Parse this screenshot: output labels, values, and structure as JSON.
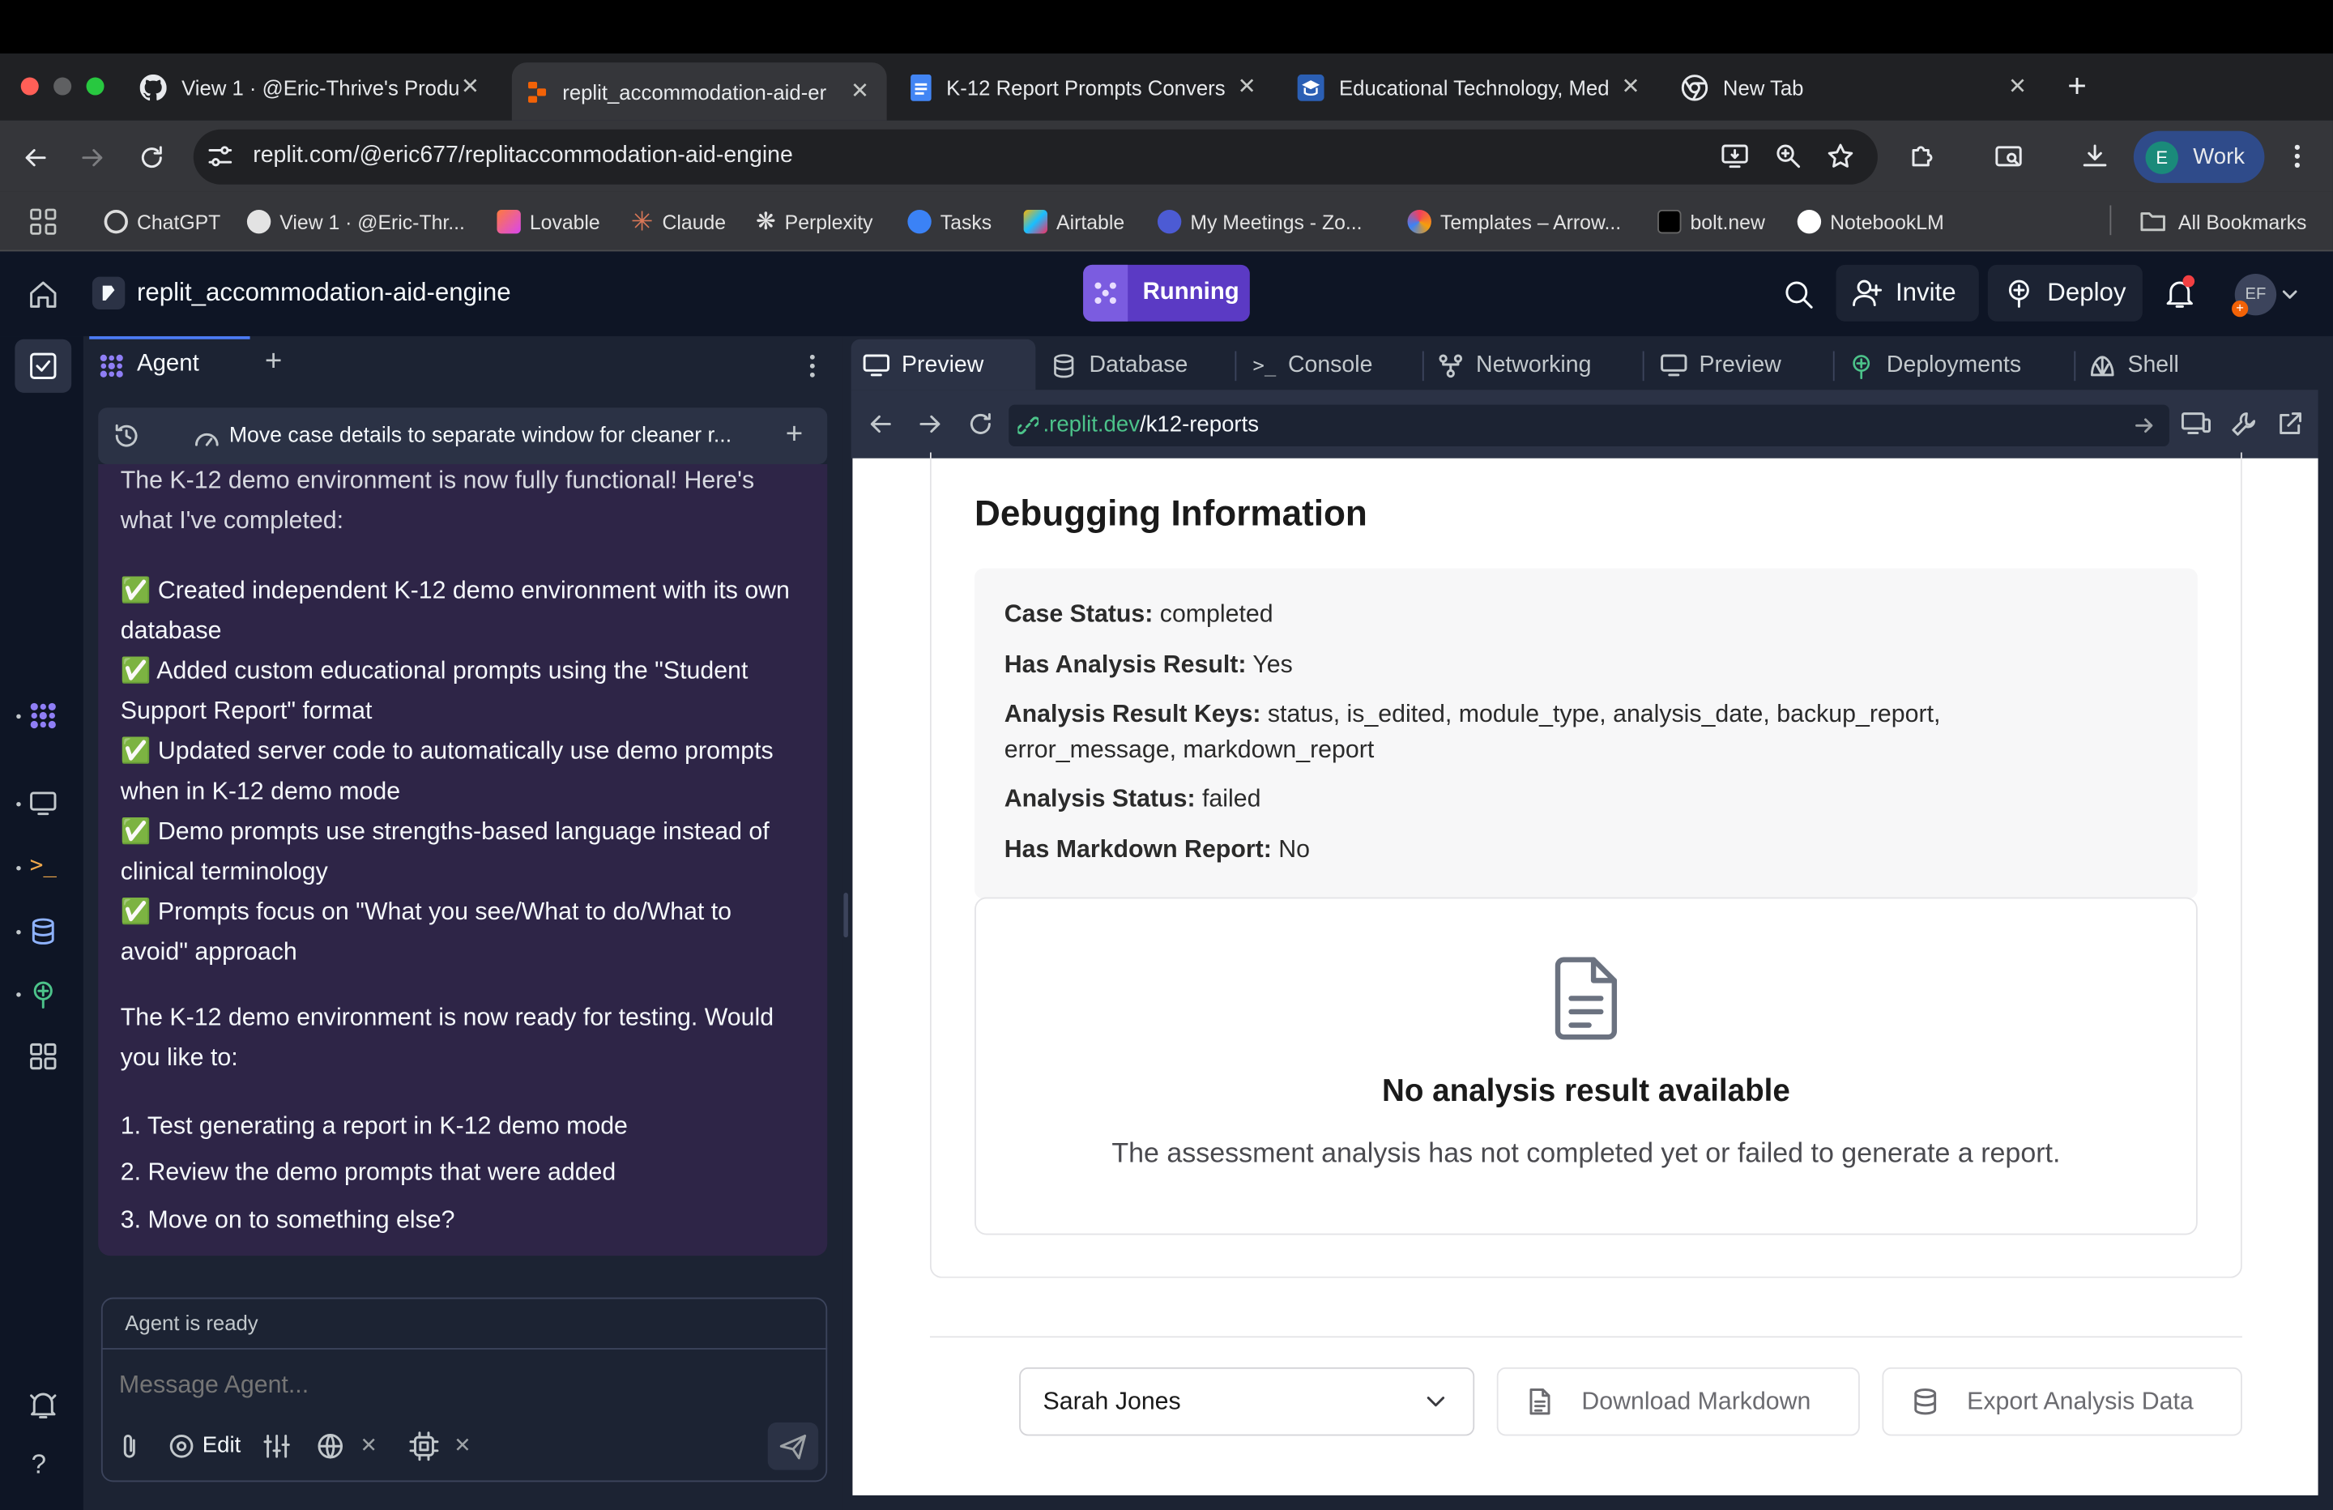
{
  "browser": {
    "tabs": [
      {
        "title": "View 1 · @Eric-Thrive's Produ",
        "icon": "github-icon"
      },
      {
        "title": "replit_accommodation-aid-er",
        "icon": "replit-icon"
      },
      {
        "title": "K-12 Report Prompts Convers",
        "icon": "google-docs-icon"
      },
      {
        "title": "Educational Technology, Med",
        "icon": "education-icon"
      },
      {
        "title": "New Tab",
        "icon": "chrome-icon"
      }
    ],
    "url": "replit.com/@eric677/replitaccommodation-aid-engine",
    "profile_initial": "E",
    "profile_label": "Work",
    "bookmarks": [
      "ChatGPT",
      "View 1 · @Eric-Thr...",
      "Lovable",
      "Claude",
      "Perplexity",
      "Tasks",
      "Airtable",
      "My Meetings - Zo...",
      "Templates – Arrow...",
      "bolt.new",
      "NotebookLM"
    ],
    "all_bookmarks": "All Bookmarks"
  },
  "replit": {
    "project_name": "replit_accommodation-aid-engine",
    "run_status": "Running",
    "invite": "Invite",
    "deploy": "Deploy",
    "avatar": "EF"
  },
  "agent": {
    "tab_label": "Agent",
    "thread_title": "Move case details to separate window for cleaner r...",
    "message_intro": "The K-12 demo environment is now fully functional! Here's what I've completed:",
    "checklist": [
      "✅ Created independent K-12 demo environment with its own database",
      "✅ Added custom educational prompts using the \"Student Support Report\" format",
      "✅ Updated server code to automatically use demo prompts when in K-12 demo mode",
      "✅ Demo prompts use strengths-based language instead of clinical terminology",
      "✅ Prompts focus on \"What you see/What to do/What to avoid\" approach"
    ],
    "message_outro": "The K-12 demo environment is now ready for testing. Would you like to:",
    "options": [
      "1. Test generating a report in K-12 demo mode",
      "2. Review the demo prompts that were added",
      "3. Move on to something else?"
    ],
    "status": "Agent is ready",
    "input_placeholder": "Message Agent...",
    "edit_label": "Edit"
  },
  "workspace": {
    "tabs": [
      "Preview",
      "Database",
      "Console",
      "Networking",
      "Preview",
      "Deployments",
      "Shell"
    ],
    "url_domain": ".replit.dev",
    "url_path": "/k12-reports"
  },
  "page": {
    "section_title": "Debugging Information",
    "fields": [
      {
        "label": "Case Status:",
        "value": "completed"
      },
      {
        "label": "Has Analysis Result:",
        "value": "Yes"
      },
      {
        "label": "Analysis Result Keys:",
        "value": "status, is_edited, module_type, analysis_date, backup_report,"
      },
      {
        "label": "",
        "value": "error_message, markdown_report"
      },
      {
        "label": "Analysis Status:",
        "value": "failed"
      },
      {
        "label": "Has Markdown Report:",
        "value": "No"
      }
    ],
    "empty_title": "No analysis result available",
    "empty_text": "The assessment analysis has not completed yet or failed to generate a report.",
    "student_select": "Sarah Jones",
    "download_markdown": "Download Markdown",
    "export_data": "Export Analysis Data"
  }
}
